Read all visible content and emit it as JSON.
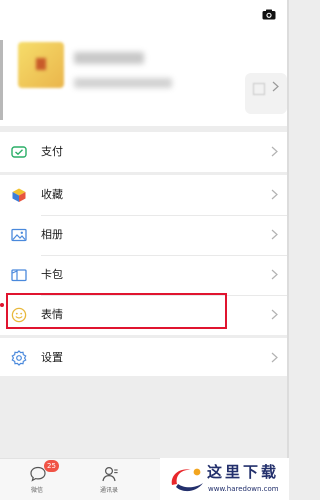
{
  "header": {
    "camera_icon": "camera-icon"
  },
  "profile": {
    "name": "",
    "wechat_id": "",
    "qr_icon": "qr-code-icon",
    "chevron_icon": "chevron-right-icon"
  },
  "menu": {
    "group1": [
      {
        "label": "支付",
        "icon": "payment-icon",
        "color": "#2aae67"
      }
    ],
    "group2": [
      {
        "label": "收藏",
        "icon": "favorites-icon",
        "color": "#4a89dc"
      },
      {
        "label": "相册",
        "icon": "album-icon",
        "color": "#4a89dc"
      },
      {
        "label": "卡包",
        "icon": "card-wallet-icon",
        "color": "#4a89dc"
      },
      {
        "label": "表情",
        "icon": "sticker-icon",
        "color": "#e8b83c"
      }
    ],
    "group3": [
      {
        "label": "设置",
        "icon": "settings-icon",
        "color": "#4a89dc"
      }
    ]
  },
  "highlight": {
    "target": "表情",
    "color": "#e0142f"
  },
  "tabbar": {
    "tabs": [
      {
        "label": "微信",
        "icon": "chat-icon",
        "badge": "25"
      },
      {
        "label": "通讯录",
        "icon": "contacts-icon"
      }
    ],
    "badge_color": "#f05346"
  },
  "watermark": {
    "title": "这里下载",
    "url": "www.haredown.com",
    "color": "#23306c"
  }
}
